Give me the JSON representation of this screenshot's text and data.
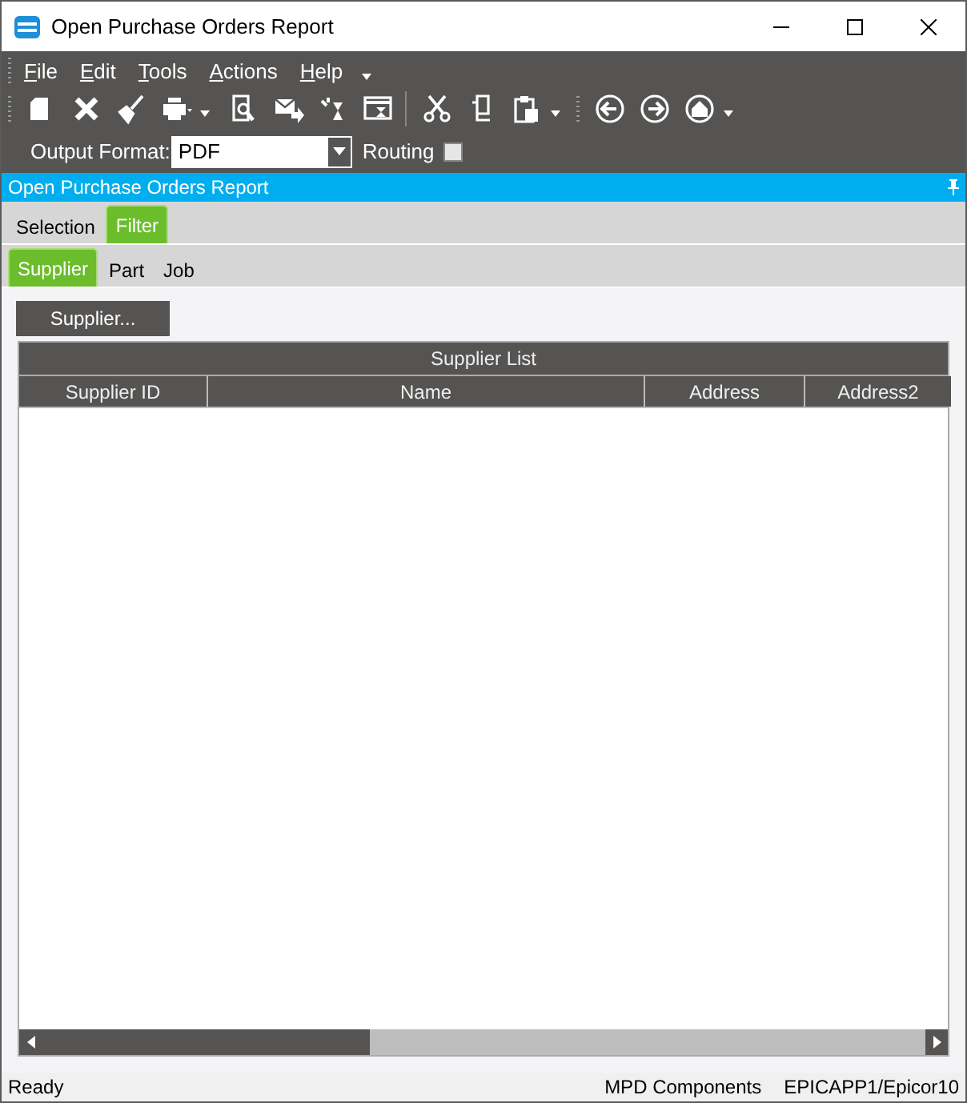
{
  "window": {
    "title": "Open Purchase Orders Report"
  },
  "menu": [
    "File",
    "Edit",
    "Tools",
    "Actions",
    "Help"
  ],
  "output_format": {
    "label": "Output Format:",
    "value": "PDF"
  },
  "routing": {
    "label": "Routing",
    "checked": false
  },
  "panel_title": "Open Purchase Orders Report",
  "tabs": [
    {
      "label": "Selection",
      "selected": false
    },
    {
      "label": "Filter",
      "selected": true
    }
  ],
  "subtabs": [
    {
      "label": "Supplier",
      "selected": true
    },
    {
      "label": "Part",
      "selected": false
    },
    {
      "label": "Job",
      "selected": false
    }
  ],
  "supplier_button": "Supplier...",
  "table": {
    "title": "Supplier List",
    "columns": [
      "Supplier ID",
      "Name",
      "Address",
      "Address2"
    ]
  },
  "status_bar": {
    "status": "Ready",
    "company": "MPD Components",
    "server": "EPICAPP1/Epicor10"
  }
}
